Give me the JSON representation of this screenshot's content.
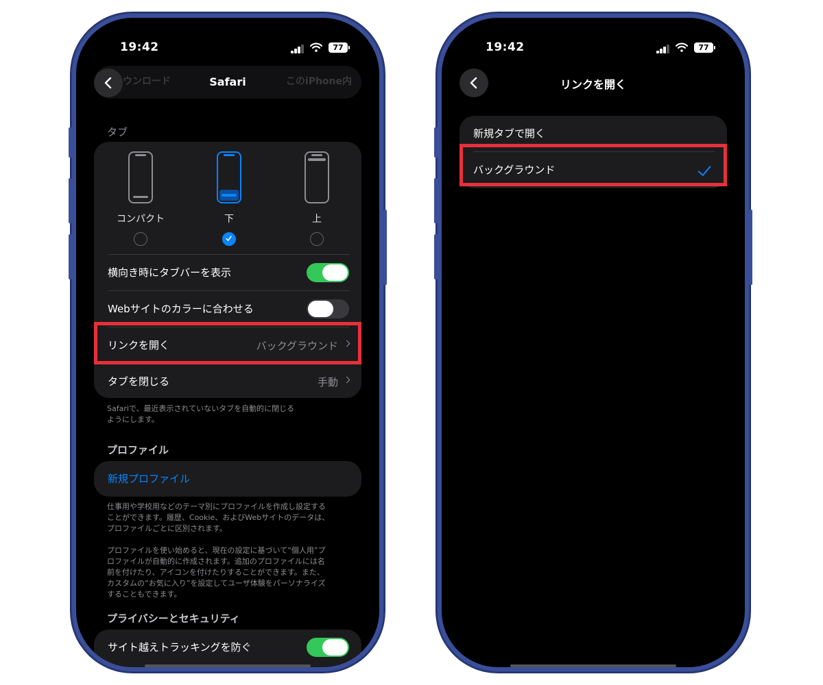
{
  "left": {
    "status": {
      "time": "19:42",
      "battery": "77"
    },
    "nav": {
      "title": "Safari",
      "ghost_left": "ウンロード",
      "ghost_right": "このiPhone内"
    },
    "tabs_section": {
      "header": "タブ",
      "options": [
        {
          "label": "コンパクト",
          "selected": false
        },
        {
          "label": "下",
          "selected": true
        },
        {
          "label": "上",
          "selected": false
        }
      ],
      "rows": {
        "landscape_tabbar": {
          "label": "横向き時にタブバーを表示",
          "on": true
        },
        "website_color": {
          "label": "Webサイトのカラーに合わせる",
          "on": false
        },
        "open_links": {
          "label": "リンクを開く",
          "value": "バックグラウンド"
        },
        "close_tabs": {
          "label": "タブを閉じる",
          "value": "手動"
        }
      },
      "footer_line1": "Safariで、最近表示されていないタブを自動的に閉じる",
      "footer_line2": "ようにします。"
    },
    "profile_section": {
      "header": "プロファイル",
      "new_profile": "新規プロファイル",
      "footer1_line1": "仕事用や学校用などのテーマ別にプロファイルを作成し設定する",
      "footer1_line2": "ことができます。履歴、Cookie、およびWebサイトのデータは、",
      "footer1_line3": "プロファイルごとに区別されます。",
      "footer2_line1": "プロファイルを使い始めると、現在の設定に基づいて“個人用”プ",
      "footer2_line2": "ロファイルが自動的に作成されます。追加のプロファイルには名",
      "footer2_line3": "前を付けたり、アイコンを付けたりすることができます。また、",
      "footer2_line4": "カスタムの“お気に入り”を設定してユーザ体験をパーソナライズ",
      "footer2_line5": "することもできます。"
    },
    "privacy_section": {
      "header": "プライバシーとセキュリティ",
      "prevent_tracking": {
        "label": "サイト越えトラッキングを防ぐ",
        "on": true
      }
    }
  },
  "right": {
    "status": {
      "time": "19:42",
      "battery": "77"
    },
    "nav": {
      "title": "リンクを開く"
    },
    "options": [
      {
        "label": "新規タブで開く",
        "selected": false
      },
      {
        "label": "バックグラウンド",
        "selected": true
      }
    ]
  },
  "colors": {
    "accent": "#0a84ff",
    "toggle_on": "#34c759",
    "highlight": "#e8303a",
    "frame": "#3a4f9a"
  }
}
